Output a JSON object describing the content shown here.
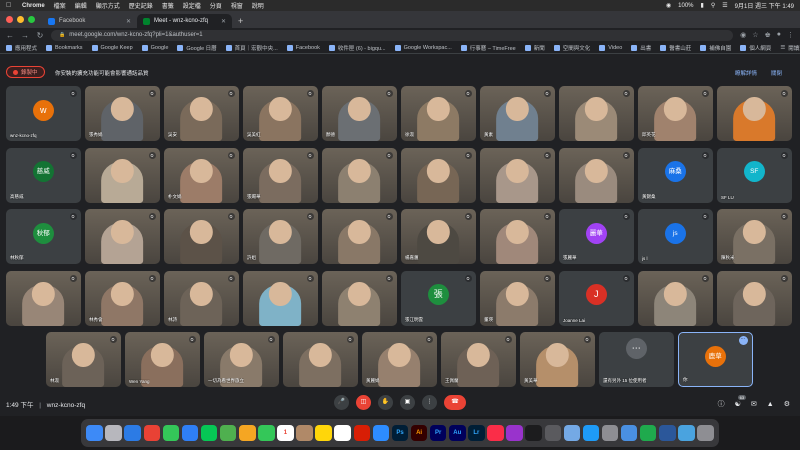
{
  "menubar": {
    "app": "Chrome",
    "items": [
      "檔案",
      "編輯",
      "顯示方式",
      "歷史記錄",
      "書籤",
      "設定檔",
      "分頁",
      "視窗",
      "說明"
    ],
    "battery": "100%",
    "clock": "9月1日 週三 下午 1:49"
  },
  "tabs": [
    {
      "title": "Facebook",
      "active": false,
      "color": "#1877f2"
    },
    {
      "title": "Meet - wnz-kcno-zfq",
      "active": true,
      "color": "#00832d"
    }
  ],
  "address": {
    "url": "meet.google.com/wnz-kcno-zfq?pli=1&authuser=1"
  },
  "bookmarks": [
    "應用程式",
    "Bookmarks",
    "Google Keep",
    "Google",
    "Google 日曆",
    "首頁｜宏觀中央...",
    "Facebook",
    "收件匣 (6) - bigqu...",
    "Google Workspac...",
    "行事曆 – TimeFree",
    "新聞",
    "空間與文化",
    "Video",
    "出書",
    "醫書山莊",
    "補佛自園",
    "個人網頁"
  ],
  "bookmarks_right": "閱讀清單",
  "recording": {
    "badge": "錄製中",
    "message": "你安裝的擴充功能可能會影響通話品質",
    "actions": [
      "瞭解詳情",
      "關閉"
    ]
  },
  "participants": [
    {
      "name": "wnz-kcno-zfq",
      "avatar": "w",
      "color": "#e8710a"
    },
    {
      "name": "張秀娟",
      "avatar": "",
      "color": "#5f6368"
    },
    {
      "name": "吳安",
      "avatar": "",
      "color": "#7a6a5a"
    },
    {
      "name": "吳美紅",
      "avatar": "",
      "color": "#8a7460"
    },
    {
      "name": "顏德",
      "avatar": "",
      "color": "#6b6f73"
    },
    {
      "name": "徐淑",
      "avatar": "",
      "color": "#8d7a64"
    },
    {
      "name": "黃素",
      "avatar": "",
      "color": "#70808f"
    },
    {
      "name": "",
      "avatar": "",
      "color": "#9b8a77"
    },
    {
      "name": "邱英花",
      "avatar": "",
      "color": "#a0826d"
    },
    {
      "name": "",
      "avatar": "",
      "color": "#d9792b"
    },
    {
      "name": "高慈威",
      "avatar": "慈威",
      "color": "#137333"
    },
    {
      "name": "",
      "avatar": "",
      "color": "#b8aa96"
    },
    {
      "name": "朴文娟",
      "avatar": "",
      "color": "#9c7c68"
    },
    {
      "name": "張賜華",
      "avatar": "",
      "color": "#7b6c5f"
    },
    {
      "name": "",
      "avatar": "",
      "color": "#8c8070"
    },
    {
      "name": "",
      "avatar": "",
      "color": "#776655"
    },
    {
      "name": "",
      "avatar": "",
      "color": "#a8978a"
    },
    {
      "name": "",
      "avatar": "",
      "color": "#9a8b7e"
    },
    {
      "name": "黃錦桑",
      "avatar": "麻桑",
      "color": "#1a73e8"
    },
    {
      "name": "SF LU",
      "avatar": "SF",
      "color": "#12b5cb"
    },
    {
      "name": "林秋郁",
      "avatar": "秋郁",
      "color": "#1e8e3e"
    },
    {
      "name": "",
      "avatar": "",
      "color": "#b4a394"
    },
    {
      "name": "",
      "avatar": "",
      "color": "#5c5248"
    },
    {
      "name": "許姐",
      "avatar": "",
      "color": "#6f6a63"
    },
    {
      "name": "",
      "avatar": "",
      "color": "#897867"
    },
    {
      "name": "楊嘉蕙",
      "avatar": "",
      "color": "#4d4942"
    },
    {
      "name": "",
      "avatar": "",
      "color": "#a0887a"
    },
    {
      "name": "張麗華",
      "avatar": "麗華",
      "color": "#a142f4"
    },
    {
      "name": "js l",
      "avatar": "js",
      "color": "#1a73e8"
    },
    {
      "name": "陳秋米",
      "avatar": "",
      "color": "#7a7064"
    },
    {
      "name": "",
      "avatar": "",
      "color": "#988677"
    },
    {
      "name": "林秀會",
      "avatar": "",
      "color": "#8f7766"
    },
    {
      "name": "林詩",
      "avatar": "",
      "color": "#6d6358"
    },
    {
      "name": "",
      "avatar": "",
      "color": "#7fb2c7"
    },
    {
      "name": "",
      "avatar": "",
      "color": "#8e8170"
    },
    {
      "name": "張江明雲",
      "avatar": "張",
      "color": "#1e8e3e"
    },
    {
      "name": "董瑛",
      "avatar": "",
      "color": "#8c7b6b"
    },
    {
      "name": "Joanne Lai",
      "avatar": "J",
      "color": "#d93025"
    },
    {
      "name": "",
      "avatar": "",
      "color": "#8d8579"
    },
    {
      "name": "",
      "avatar": "",
      "color": "#6e655c"
    },
    {
      "name": "",
      "avatar": "",
      "color": "#a29585"
    },
    {
      "name": "林淑",
      "avatar": "",
      "color": "#6c6258"
    },
    {
      "name": "Wen Yang",
      "avatar": "",
      "color": "#8a6f5d"
    },
    {
      "name": "一切為看世界旅立",
      "avatar": "",
      "color": "#897a6a"
    },
    {
      "name": "",
      "avatar": "",
      "color": "#7d6f61"
    },
    {
      "name": "黃麗娟",
      "avatar": "",
      "color": "#96806e"
    },
    {
      "name": "王佩蘭",
      "avatar": "",
      "color": "#6e6156"
    },
    {
      "name": "黃美華",
      "avatar": "",
      "color": "#b58f6a"
    }
  ],
  "others": {
    "label": "還有另外 15 位使用者"
  },
  "self": {
    "name": "你",
    "avatar": "鹿草",
    "color": "#e8710a"
  },
  "bottom": {
    "time": "1:49 下午",
    "code": "wnz-kcno-zfq",
    "people_count": "63"
  },
  "dock": {
    "apps": [
      "Finder",
      "Launchpad",
      "Safari",
      "Chrome",
      "Messages",
      "Mail",
      "LINE",
      "Maps",
      "Photos",
      "FaceTime",
      "Calendar",
      "Contacts",
      "Notes",
      "Reminders",
      "Acrobat",
      "Zoom",
      "Ps",
      "Ai",
      "Pr",
      "Au",
      "Lr",
      "Music",
      "Podcasts",
      "TV",
      "Calculator",
      "Preview",
      "App Store",
      "Settings",
      "Keynote",
      "Numbers",
      "Word",
      "Folder",
      "Trash"
    ],
    "calendar_day": "1"
  }
}
